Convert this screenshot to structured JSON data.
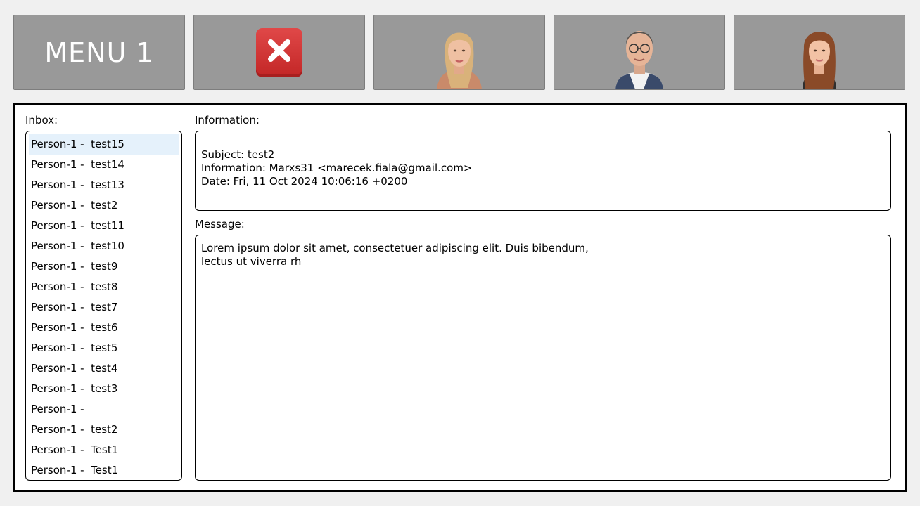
{
  "toolbar": {
    "menu_label": "MENU 1",
    "close_icon": "close-icon",
    "close_color": "#d32f2f",
    "avatars": [
      "avatar-woman-blonde",
      "avatar-man-glasses",
      "avatar-woman-redhead"
    ]
  },
  "inbox": {
    "label": "Inbox:",
    "items": [
      {
        "label": "Person-1 -  test15",
        "selected": true
      },
      {
        "label": "Person-1 -  test14"
      },
      {
        "label": "Person-1 -  test13"
      },
      {
        "label": "Person-1 -  test2"
      },
      {
        "label": "Person-1 -  test11"
      },
      {
        "label": "Person-1 -  test10"
      },
      {
        "label": "Person-1 -  test9"
      },
      {
        "label": "Person-1 -  test8"
      },
      {
        "label": "Person-1 -  test7"
      },
      {
        "label": "Person-1 -  test6"
      },
      {
        "label": "Person-1 -  test5"
      },
      {
        "label": "Person-1 -  test4"
      },
      {
        "label": "Person-1 -  test3"
      },
      {
        "label": "Person-1 - "
      },
      {
        "label": "Person-1 -  test2"
      },
      {
        "label": "Person-1 -  Test1"
      },
      {
        "label": "Person-1 -  Test1"
      }
    ]
  },
  "information": {
    "label": "Information:",
    "subject": "Subject: test2",
    "from": "Information: Marxs31 <marecek.fiala@gmail.com>",
    "date": "Date: Fri, 11 Oct 2024 10:06:16 +0200"
  },
  "message": {
    "label": "Message:",
    "lines": [
      "Lorem ipsum dolor sit amet, consectetuer adipiscing elit. Duis bibendum,",
      "lectus ut viverra rh"
    ]
  }
}
